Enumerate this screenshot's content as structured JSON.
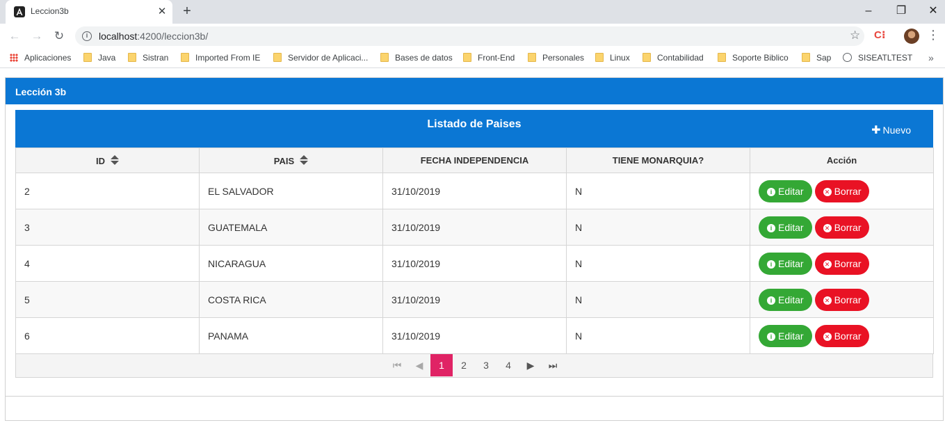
{
  "browser": {
    "tab_title": "Leccion3b",
    "url_host": "localhost",
    "url_path": ":4200/leccion3b/",
    "ext_label": "C⁝",
    "bookmarks": [
      "Aplicaciones",
      "Java",
      "Sistran",
      "Imported From IE",
      "Servidor de Aplicaci...",
      "Bases de datos",
      "Front-End",
      "Personales",
      "Linux",
      "Contabilidad",
      "Soporte Biblico",
      "Sap",
      "SISEATLTEST"
    ]
  },
  "card": {
    "title": "Lección 3b"
  },
  "table": {
    "caption": "Listado de Paises",
    "new_label": "Nuevo",
    "headers": {
      "id": "ID",
      "pais": "PAIS",
      "fecha": "FECHA INDEPENDENCIA",
      "monarquia": "TIENE MONARQUIA?",
      "accion": "Acción"
    },
    "edit_label": "Editar",
    "delete_label": "Borrar",
    "rows": [
      {
        "id": "2",
        "pais": "EL SALVADOR",
        "fecha": "31/10/2019",
        "monarquia": "N"
      },
      {
        "id": "3",
        "pais": "GUATEMALA",
        "fecha": "31/10/2019",
        "monarquia": "N"
      },
      {
        "id": "4",
        "pais": "NICARAGUA",
        "fecha": "31/10/2019",
        "monarquia": "N"
      },
      {
        "id": "5",
        "pais": "COSTA RICA",
        "fecha": "31/10/2019",
        "monarquia": "N"
      },
      {
        "id": "6",
        "pais": "PANAMA",
        "fecha": "31/10/2019",
        "monarquia": "N"
      }
    ]
  },
  "paginator": {
    "pages": [
      "1",
      "2",
      "3",
      "4"
    ],
    "current": "1"
  },
  "colors": {
    "primary": "#0b77d4",
    "edit": "#34a835",
    "delete": "#e91224",
    "page_active": "#e02365"
  }
}
